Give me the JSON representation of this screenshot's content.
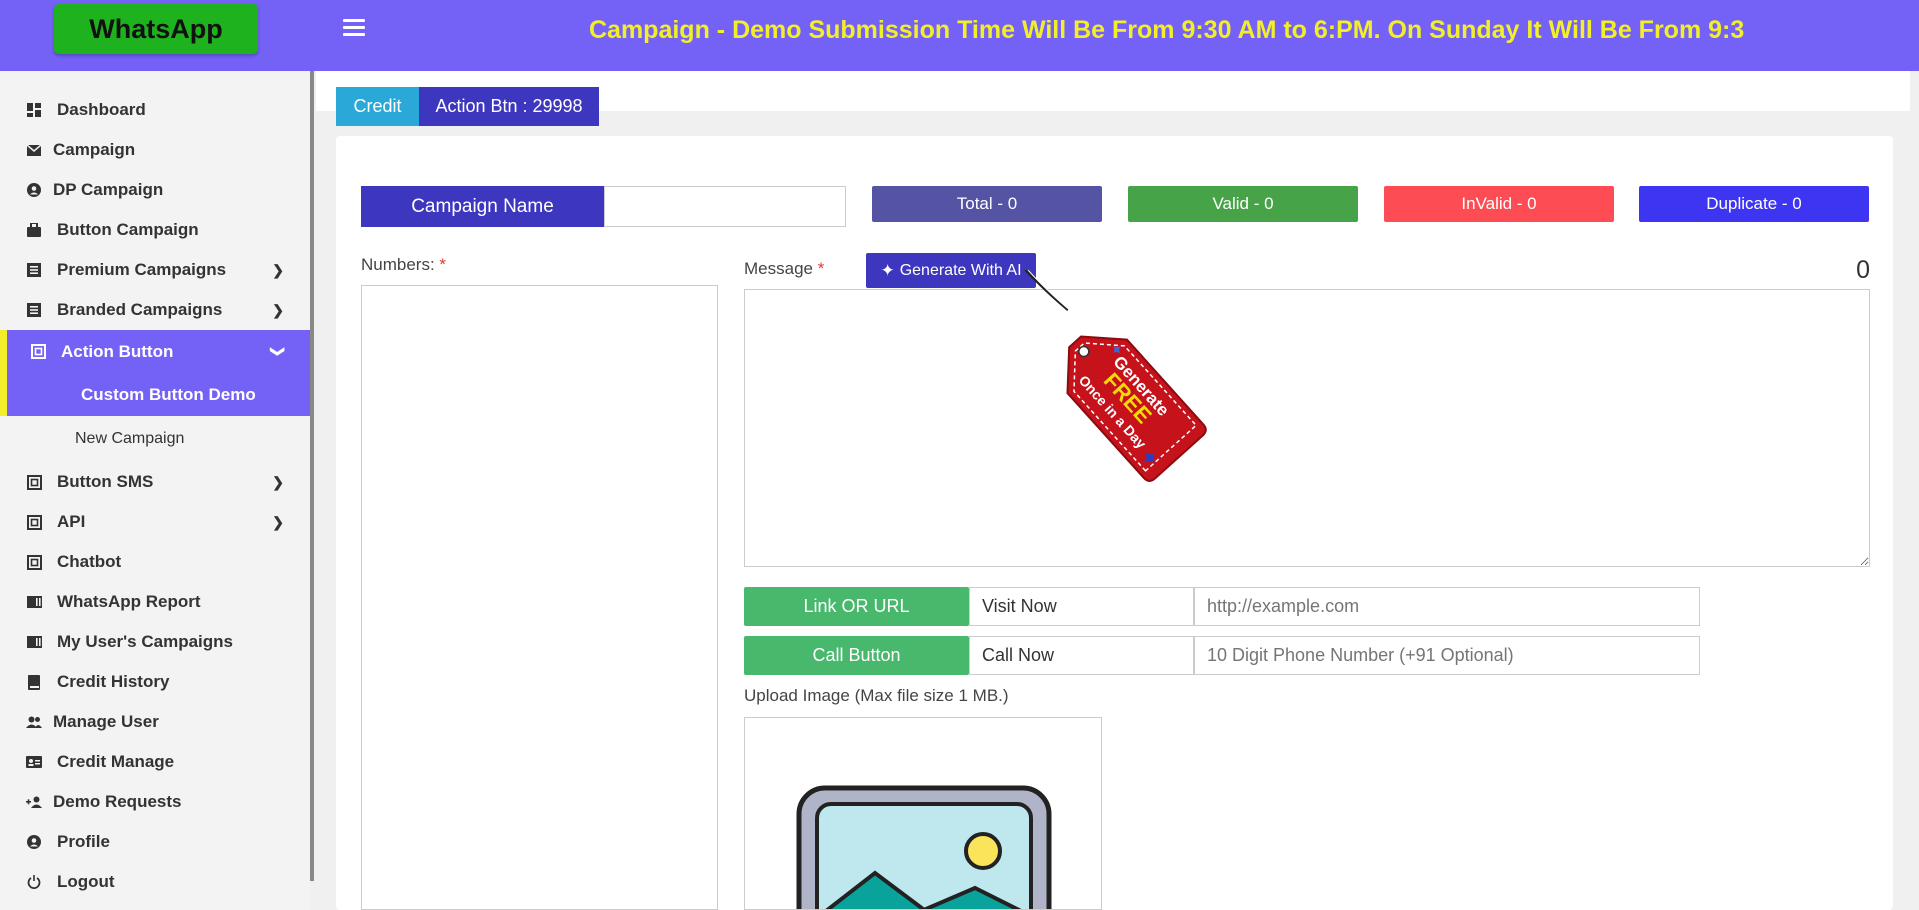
{
  "header": {
    "logo": "WhatsApp",
    "marquee": "Campaign - Demo Submission Time Will Be From 9:30 AM to 6:PM. On Sunday It Will Be From 9:3"
  },
  "sidebar": {
    "items": [
      {
        "label": "Dashboard",
        "icon": "dashboard-icon"
      },
      {
        "label": "Campaign",
        "icon": "envelope-icon"
      },
      {
        "label": "DP Campaign",
        "icon": "user-circle-icon"
      },
      {
        "label": "Button Campaign",
        "icon": "bag-icon"
      },
      {
        "label": "Premium Campaigns",
        "icon": "list-icon"
      },
      {
        "label": "Branded Campaigns",
        "icon": "list-icon"
      },
      {
        "label": "Action Button",
        "icon": "frame-icon"
      },
      {
        "label": "Custom Button Demo"
      },
      {
        "label": "New Campaign"
      },
      {
        "label": "Button SMS",
        "icon": "frame-icon"
      },
      {
        "label": "API",
        "icon": "frame-icon"
      },
      {
        "label": "Chatbot",
        "icon": "frame-icon"
      },
      {
        "label": "WhatsApp Report",
        "icon": "bar-chart-icon"
      },
      {
        "label": "My User's Campaigns",
        "icon": "bar-chart-icon"
      },
      {
        "label": "Credit History",
        "icon": "book-icon"
      },
      {
        "label": "Manage User",
        "icon": "users-icon"
      },
      {
        "label": "Credit Manage",
        "icon": "id-card-icon"
      },
      {
        "label": "Demo Requests",
        "icon": "user-plus-icon"
      },
      {
        "label": "Profile",
        "icon": "user-circle-icon"
      },
      {
        "label": "Logout",
        "icon": "power-icon"
      }
    ]
  },
  "tabs": {
    "credit": "Credit",
    "action_btn": "Action Btn : 29998"
  },
  "form": {
    "campaign_name_label": "Campaign Name",
    "campaign_name_value": "",
    "stats": {
      "total": "Total - 0",
      "valid": "Valid - 0",
      "invalid": "InValid - 0",
      "duplicate": "Duplicate - 0"
    },
    "numbers_label": "Numbers:",
    "message_label": "Message",
    "required_mark": "*",
    "generate_ai": "Generate With AI",
    "char_count": "0",
    "tag": {
      "line1": "Generate",
      "line2": "FREE",
      "line3": "Once in a Day"
    },
    "link_button": "Link OR URL",
    "link_name": "Visit Now",
    "link_placeholder": "http://example.com",
    "call_button": "Call Button",
    "call_name": "Call Now",
    "call_placeholder": "10 Digit Phone Number (+91 Optional)",
    "upload_label": "Upload Image (Max file size 1 MB.)"
  },
  "colors": {
    "primary": "#7462f6",
    "accent_yellow": "#f3ee2a",
    "indigo": "#3d36be",
    "green": "#47b86c",
    "red": "#fd4c53"
  }
}
